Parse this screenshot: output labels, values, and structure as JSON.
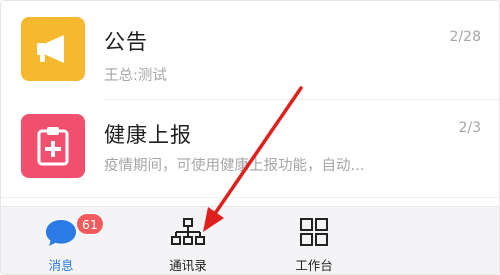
{
  "list": {
    "items": [
      {
        "title": "公告",
        "subtitle": "王总:测试",
        "count": "2/28",
        "icon": "megaphone-icon",
        "icon_color": "#f5b82e"
      },
      {
        "title": "健康上报",
        "subtitle": "疫情期间，可使用健康上报功能，自动...",
        "count": "2/3",
        "icon": "clipboard-plus-icon",
        "icon_color": "#f0506e"
      }
    ]
  },
  "tabbar": {
    "tabs": [
      {
        "label": "消息",
        "icon": "chat-bubble-icon",
        "badge": "61",
        "active": true
      },
      {
        "label": "通讯录",
        "icon": "org-chart-icon"
      },
      {
        "label": "工作台",
        "icon": "grid-icon"
      }
    ]
  },
  "colors": {
    "accent": "#2a7be4",
    "badge": "#f15b5b",
    "annotation_arrow": "#e0201c"
  }
}
